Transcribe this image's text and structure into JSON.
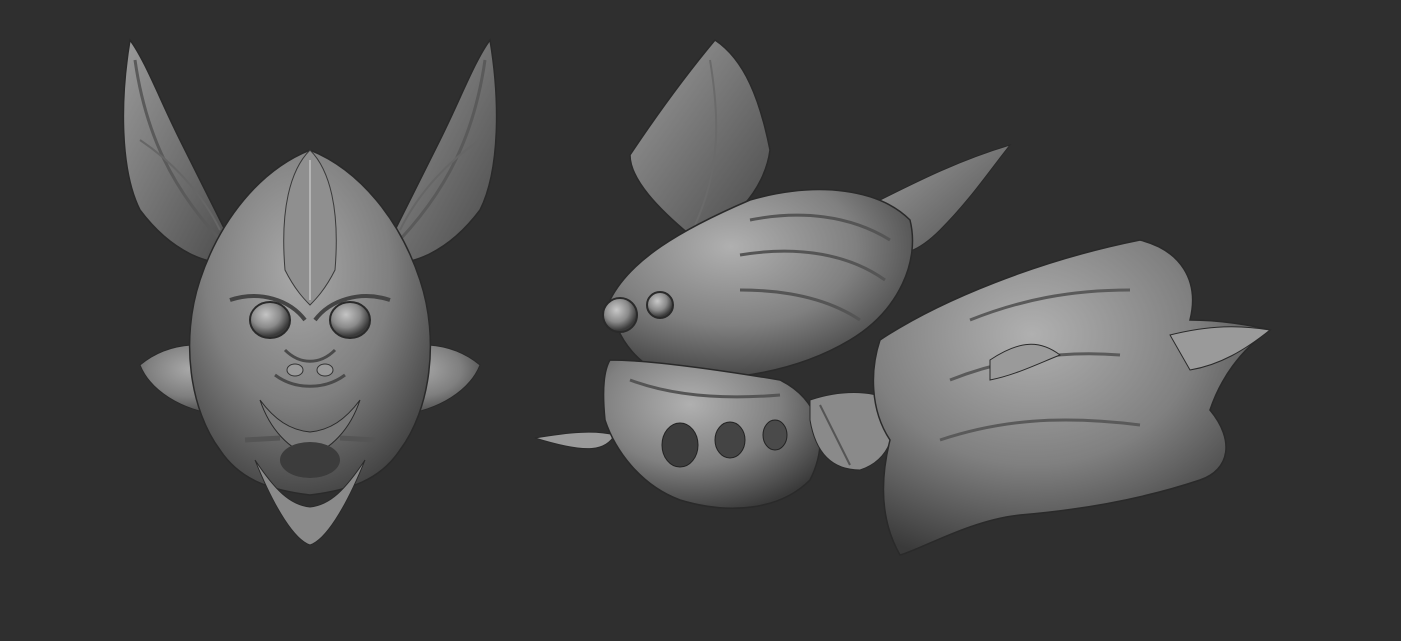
{
  "scene": {
    "background_color": "#2f2f2f",
    "material_color": "#8c8c8c",
    "views": [
      {
        "name": "front-view"
      },
      {
        "name": "side-view"
      }
    ]
  }
}
